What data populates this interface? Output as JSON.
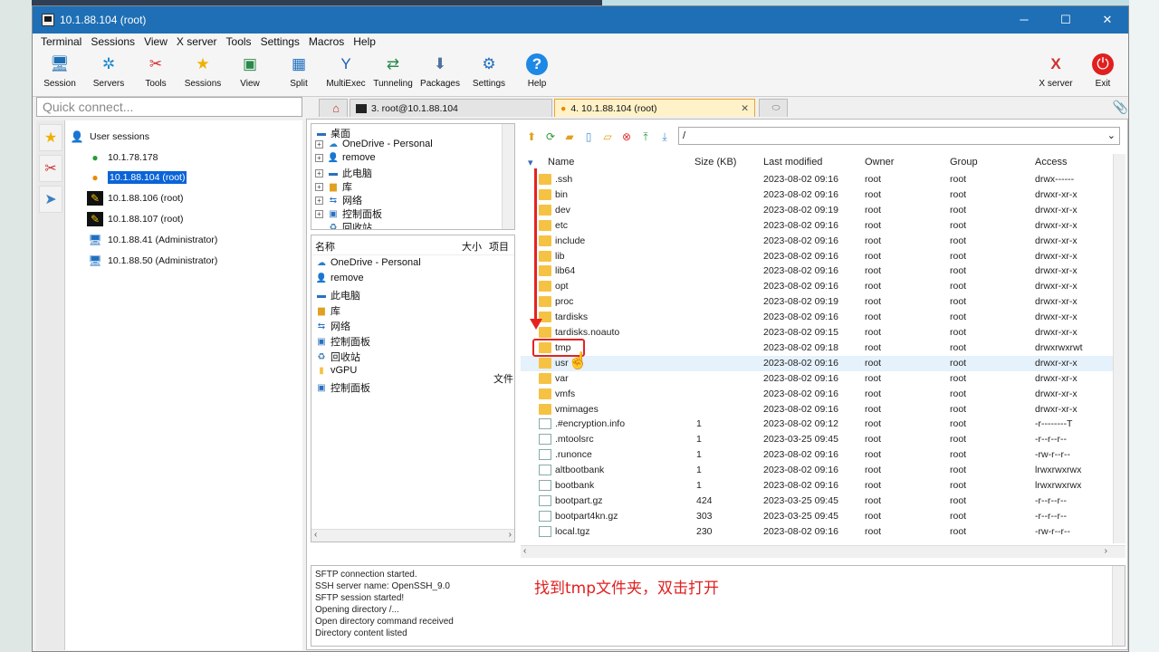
{
  "window": {
    "title": "10.1.88.104 (root)",
    "controls": [
      "─",
      "☐",
      "✕"
    ]
  },
  "menu": [
    "Terminal",
    "Sessions",
    "View",
    "X server",
    "Tools",
    "Settings",
    "Macros",
    "Help"
  ],
  "toolbar": {
    "items": [
      {
        "label": "Session",
        "icon": "monitor-icon"
      },
      {
        "label": "Servers",
        "icon": "servers-icon"
      },
      {
        "label": "Tools",
        "icon": "tools-icon"
      },
      {
        "label": "Sessions",
        "icon": "star-icon"
      },
      {
        "label": "View",
        "icon": "view-icon"
      },
      {
        "label": "Split",
        "icon": "split-icon"
      },
      {
        "label": "MultiExec",
        "icon": "multiexec-icon"
      },
      {
        "label": "Tunneling",
        "icon": "tunneling-icon"
      },
      {
        "label": "Packages",
        "icon": "packages-icon"
      },
      {
        "label": "Settings",
        "icon": "settings-icon"
      },
      {
        "label": "Help",
        "icon": "help-icon"
      }
    ],
    "right": [
      {
        "label": "X server",
        "icon": "xserver-icon"
      },
      {
        "label": "Exit",
        "icon": "exit-icon"
      }
    ]
  },
  "quick_connect": {
    "placeholder": "Quick connect..."
  },
  "sessions": {
    "root": "User sessions",
    "items": [
      "10.1.78.178",
      "10.1.88.104 (root)",
      "10.1.88.106 (root)",
      "10.1.88.107 (root)",
      "10.1.88.41 (Administrator)",
      "10.1.88.50 (Administrator)"
    ],
    "selected": "10.1.88.104 (root)"
  },
  "tabs": [
    {
      "label": "3. root@10.1.88.104"
    },
    {
      "label": "4. 10.1.88.104 (root)"
    }
  ],
  "left_tree": {
    "root": "桌面",
    "items": [
      "OneDrive - Personal",
      "remove",
      "此电脑",
      "库",
      "网络",
      "控制面板",
      "回收站"
    ]
  },
  "left_list": {
    "headers": [
      "名称",
      "大小",
      "项目"
    ],
    "items": [
      "OneDrive - Personal",
      "remove",
      "此电脑",
      "库",
      "网络",
      "控制面板",
      "回收站",
      "vGPU",
      "控制面板"
    ],
    "side_label": "文件"
  },
  "file_pane": {
    "path": "/",
    "headers": [
      "Name",
      "Size (KB)",
      "Last modified",
      "Owner",
      "Group",
      "Access"
    ],
    "rows": [
      {
        "name": ".ssh",
        "type": "folder",
        "size": "",
        "modified": "2023-08-02 09:16",
        "owner": "root",
        "group": "root",
        "access": "drwx------"
      },
      {
        "name": "bin",
        "type": "folder",
        "size": "",
        "modified": "2023-08-02 09:16",
        "owner": "root",
        "group": "root",
        "access": "drwxr-xr-x"
      },
      {
        "name": "dev",
        "type": "folder",
        "size": "",
        "modified": "2023-08-02 09:19",
        "owner": "root",
        "group": "root",
        "access": "drwxr-xr-x"
      },
      {
        "name": "etc",
        "type": "folder",
        "size": "",
        "modified": "2023-08-02 09:16",
        "owner": "root",
        "group": "root",
        "access": "drwxr-xr-x"
      },
      {
        "name": "include",
        "type": "folder",
        "size": "",
        "modified": "2023-08-02 09:16",
        "owner": "root",
        "group": "root",
        "access": "drwxr-xr-x"
      },
      {
        "name": "lib",
        "type": "folder",
        "size": "",
        "modified": "2023-08-02 09:16",
        "owner": "root",
        "group": "root",
        "access": "drwxr-xr-x"
      },
      {
        "name": "lib64",
        "type": "folder",
        "size": "",
        "modified": "2023-08-02 09:16",
        "owner": "root",
        "group": "root",
        "access": "drwxr-xr-x"
      },
      {
        "name": "opt",
        "type": "folder",
        "size": "",
        "modified": "2023-08-02 09:16",
        "owner": "root",
        "group": "root",
        "access": "drwxr-xr-x"
      },
      {
        "name": "proc",
        "type": "folder",
        "size": "",
        "modified": "2023-08-02 09:19",
        "owner": "root",
        "group": "root",
        "access": "drwxr-xr-x"
      },
      {
        "name": "tardisks",
        "type": "folder",
        "size": "",
        "modified": "2023-08-02 09:16",
        "owner": "root",
        "group": "root",
        "access": "drwxr-xr-x"
      },
      {
        "name": "tardisks.noauto",
        "type": "folder",
        "size": "",
        "modified": "2023-08-02 09:15",
        "owner": "root",
        "group": "root",
        "access": "drwxr-xr-x"
      },
      {
        "name": "tmp",
        "type": "folder",
        "size": "",
        "modified": "2023-08-02 09:18",
        "owner": "root",
        "group": "root",
        "access": "drwxrwxrwt"
      },
      {
        "name": "usr",
        "type": "folder",
        "size": "",
        "modified": "2023-08-02 09:16",
        "owner": "root",
        "group": "root",
        "access": "drwxr-xr-x"
      },
      {
        "name": "var",
        "type": "folder",
        "size": "",
        "modified": "2023-08-02 09:16",
        "owner": "root",
        "group": "root",
        "access": "drwxr-xr-x"
      },
      {
        "name": "vmfs",
        "type": "folder",
        "size": "",
        "modified": "2023-08-02 09:16",
        "owner": "root",
        "group": "root",
        "access": "drwxr-xr-x"
      },
      {
        "name": "vmimages",
        "type": "folder",
        "size": "",
        "modified": "2023-08-02 09:16",
        "owner": "root",
        "group": "root",
        "access": "drwxr-xr-x"
      },
      {
        "name": ".#encryption.info",
        "type": "file",
        "size": "1",
        "modified": "2023-08-02 09:12",
        "owner": "root",
        "group": "root",
        "access": "-r--------T"
      },
      {
        "name": ".mtoolsrc",
        "type": "file",
        "size": "1",
        "modified": "2023-03-25 09:45",
        "owner": "root",
        "group": "root",
        "access": "-r--r--r--"
      },
      {
        "name": ".runonce",
        "type": "file",
        "size": "1",
        "modified": "2023-08-02 09:16",
        "owner": "root",
        "group": "root",
        "access": "-rw-r--r--"
      },
      {
        "name": "altbootbank",
        "type": "link",
        "size": "1",
        "modified": "2023-08-02 09:16",
        "owner": "root",
        "group": "root",
        "access": "lrwxrwxrwx"
      },
      {
        "name": "bootbank",
        "type": "link",
        "size": "1",
        "modified": "2023-08-02 09:16",
        "owner": "root",
        "group": "root",
        "access": "lrwxrwxrwx"
      },
      {
        "name": "bootpart.gz",
        "type": "file",
        "size": "424",
        "modified": "2023-03-25 09:45",
        "owner": "root",
        "group": "root",
        "access": "-r--r--r--"
      },
      {
        "name": "bootpart4kn.gz",
        "type": "file",
        "size": "303",
        "modified": "2023-03-25 09:45",
        "owner": "root",
        "group": "root",
        "access": "-r--r--r--"
      },
      {
        "name": "local.tgz",
        "type": "file",
        "size": "230",
        "modified": "2023-08-02 09:16",
        "owner": "root",
        "group": "root",
        "access": "-rw-r--r--"
      }
    ]
  },
  "log": [
    "SFTP connection started.",
    "SSH server name: OpenSSH_9.0",
    "SFTP session started!",
    "Opening directory /...",
    "Open directory command received",
    "Directory content listed"
  ],
  "annotation": "找到tmp文件夹，双击打开"
}
